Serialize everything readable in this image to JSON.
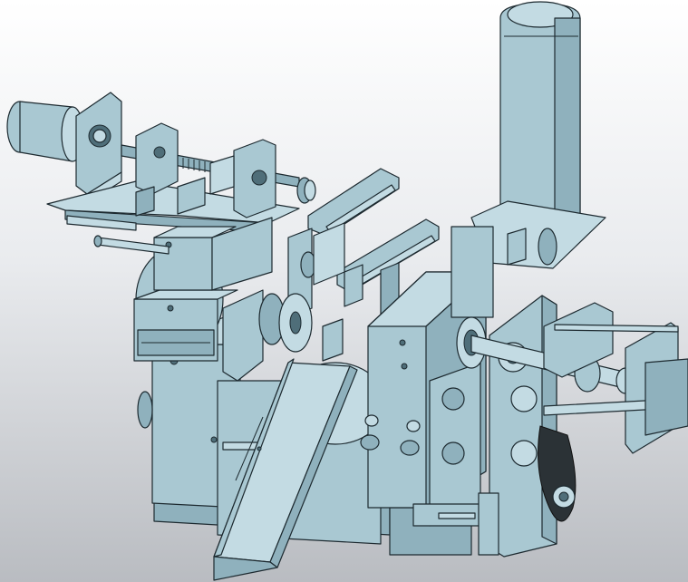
{
  "scene": {
    "background_top": "#ffffff",
    "background_bottom": "#b9bcc1",
    "part_color": "#a9c8d2",
    "edge_color": "#1d2a30"
  }
}
